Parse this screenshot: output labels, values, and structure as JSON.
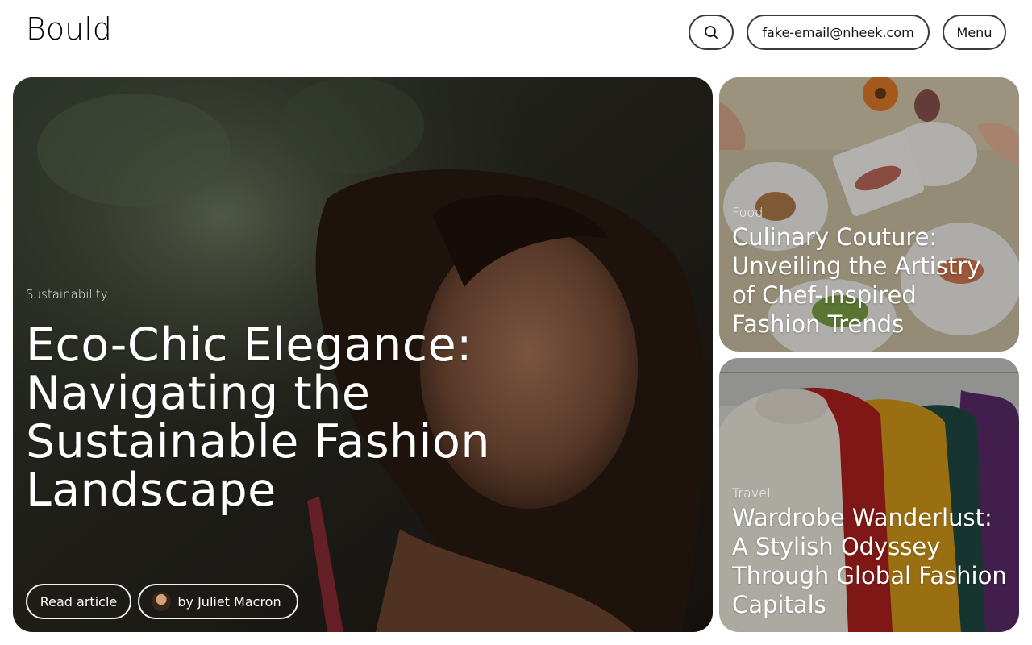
{
  "header": {
    "logo": "Bould",
    "email": "fake-email@nheek.com",
    "menu_label": "Menu",
    "search_icon": "search-icon"
  },
  "featured": {
    "category": "Sustainability",
    "title": "Eco-Chic Elegance: Navigating the Sustainable Fashion Landscape",
    "read_label": "Read article",
    "author": "by Juliet Macron"
  },
  "side_articles": [
    {
      "category": "Food",
      "title": "Culinary Couture: Unveiling the Artistry of Chef-Inspired Fashion Trends"
    },
    {
      "category": "Travel",
      "title": "Wardrobe Wanderlust: A Stylish Odyssey Through Global Fashion Capitals"
    }
  ]
}
